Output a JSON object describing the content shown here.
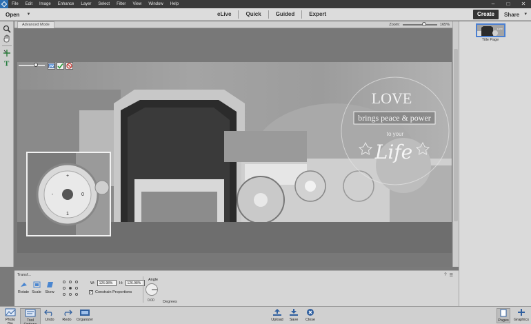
{
  "menubar": {
    "items": [
      "File",
      "Edit",
      "Image",
      "Enhance",
      "Layer",
      "Select",
      "Filter",
      "View",
      "Window",
      "Help"
    ],
    "window_controls": [
      "–",
      "□",
      "✕"
    ]
  },
  "modebar": {
    "open_label": "Open",
    "modes": [
      "eLive",
      "Quick",
      "Guided",
      "Expert"
    ],
    "create_label": "Create",
    "share_label": "Share"
  },
  "canvas": {
    "tab_label": "Advanced Mode",
    "zoom_label": "Zoom:",
    "zoom_value": "165%"
  },
  "photo": {
    "love_text": "LOVE",
    "banner_text": "brings peace & power",
    "to_your_text": "to your",
    "life_text": "Life"
  },
  "right_panel": {
    "thumbnail_label": "Title Page"
  },
  "tool_options": {
    "title": "Transf...",
    "rotate_label": "Rotate",
    "scale_label": "Scale",
    "skew_label": "Skew",
    "w_label": "W:",
    "w_value": "126.98%",
    "h_label": "H:",
    "h_value": "126.98%",
    "constrain_label": "Constrain Proportions",
    "angle_label": "Angle",
    "angle_value": "0.00",
    "degrees_label": "Degrees"
  },
  "bottombar": {
    "photo_bin": "Photo Bin",
    "tool_options": "Tool Options",
    "undo": "Undo",
    "redo": "Redo",
    "organizer": "Organizer",
    "upload": "Upload",
    "save": "Save",
    "close": "Close",
    "pages": "Pages",
    "graphics": "Graphics"
  },
  "colors": {
    "accent_blue": "#4a7fd1",
    "create_bg": "#333333",
    "menubar_bg": "#3a3a3a"
  }
}
